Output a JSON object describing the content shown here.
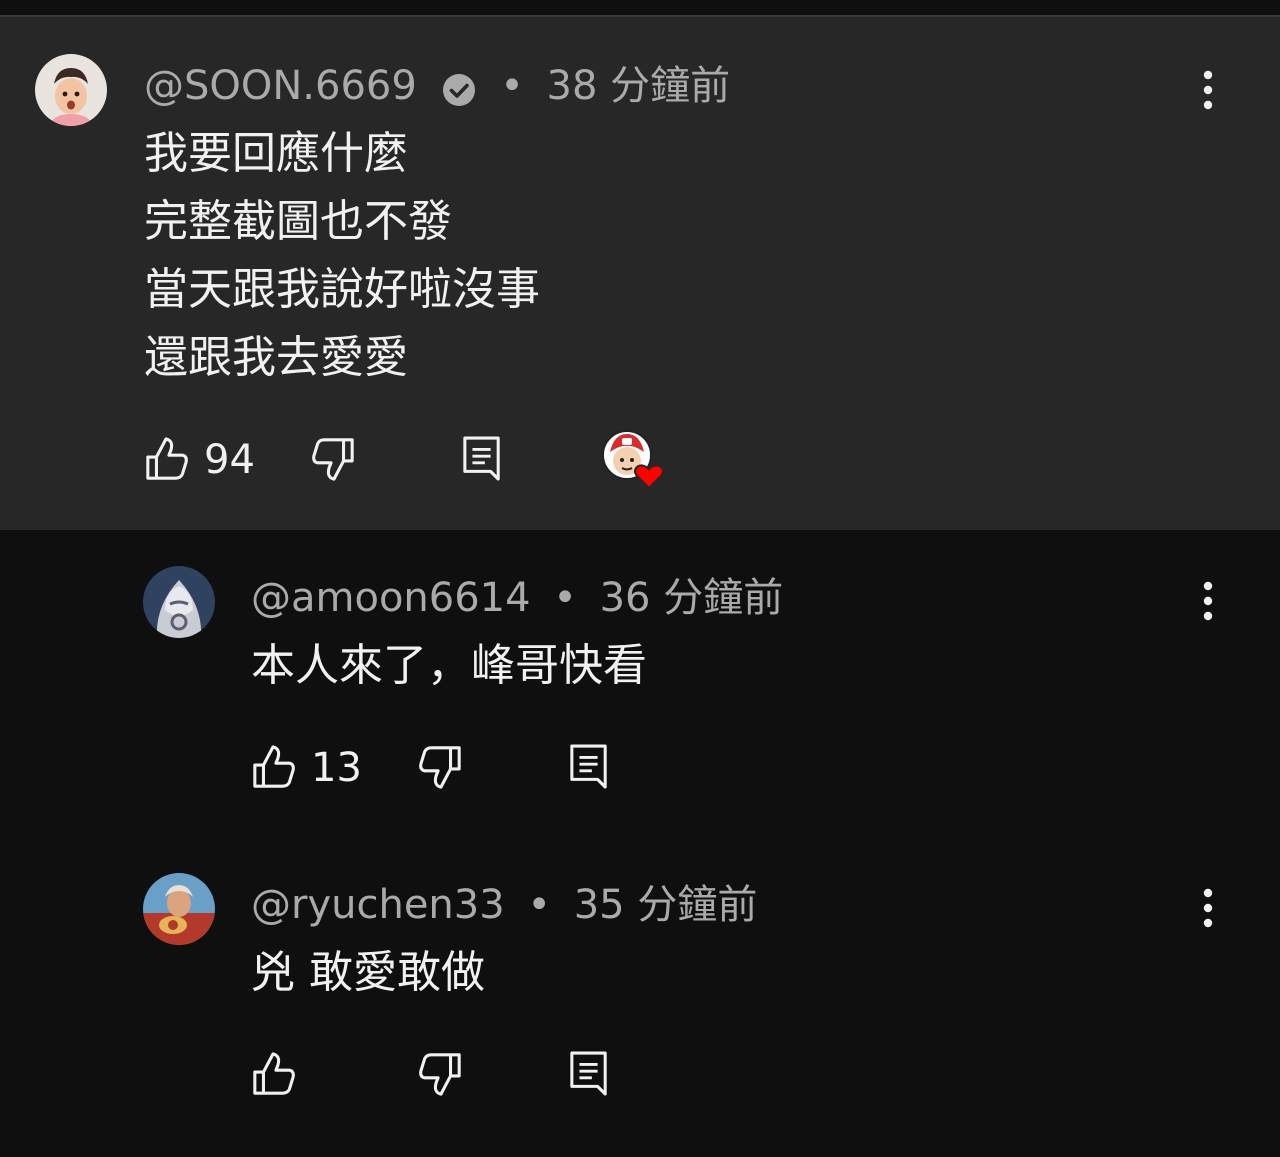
{
  "comments": [
    {
      "handle": "@SOON.6669",
      "verified": true,
      "separator": "•",
      "time": "38 分鐘前",
      "lines": [
        "我要回應什麼",
        "完整截圖也不發",
        "當天跟我說好啦沒事",
        "還跟我去愛愛"
      ],
      "likes": "94",
      "creator_heart": true,
      "highlighted": true
    },
    {
      "handle": "@amoon6614",
      "separator": "•",
      "time": "36 分鐘前",
      "lines": [
        "本人來了，峰哥快看"
      ],
      "likes": "13"
    },
    {
      "handle": "@ryuchen33",
      "separator": "•",
      "time": "35 分鐘前",
      "lines": [
        "兇 敢愛敢做"
      ],
      "likes": ""
    }
  ],
  "icons": {
    "like": "thumb-up-icon",
    "dislike": "thumb-down-icon",
    "reply": "reply-icon",
    "more": "more-vertical-icon",
    "verified": "verified-check-icon",
    "heart": "creator-heart-icon"
  },
  "colors": {
    "background": "#0f0f0f",
    "highlight_background": "#272727",
    "text": "#f1f1f1",
    "meta": "#aaaaaa",
    "heart": "#ff0000"
  }
}
